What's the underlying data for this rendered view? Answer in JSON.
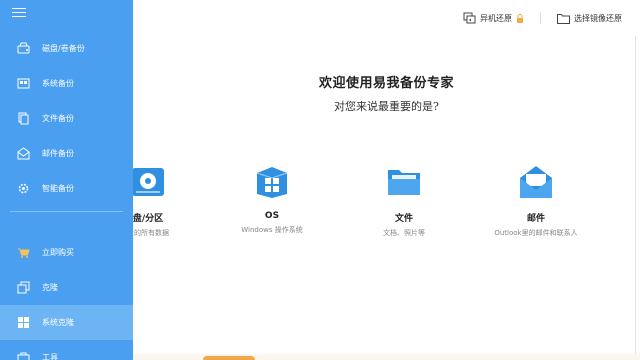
{
  "topbar": {
    "restore_label": "异机还原",
    "image_restore_label": "选择镜像还原"
  },
  "sidebar": {
    "items": [
      {
        "label": "磁盘/卷备份",
        "icon": "disk-icon"
      },
      {
        "label": "系统备份",
        "icon": "system-backup-icon"
      },
      {
        "label": "文件备份",
        "icon": "file-icon"
      },
      {
        "label": "邮件备份",
        "icon": "mail-icon"
      },
      {
        "label": "智能备份",
        "icon": "smart-backup-icon"
      },
      {
        "label": "立即购买",
        "icon": "cart-icon"
      },
      {
        "label": "克隆",
        "icon": "clone-icon"
      },
      {
        "label": "系统克隆",
        "icon": "windows-icon"
      },
      {
        "label": "工具",
        "icon": "tools-icon"
      }
    ]
  },
  "welcome": {
    "title": "欢迎使用易我备份专家",
    "subtitle": "对您来说最重要的是?"
  },
  "cards": [
    {
      "title": "盘/分区",
      "subtitle": "上的所有数据"
    },
    {
      "title": "OS",
      "subtitle": "Windows 操作系统"
    },
    {
      "title": "文件",
      "subtitle": "文档、照片等"
    },
    {
      "title": "邮件",
      "subtitle": "Outlook里的邮件和联系人"
    }
  ],
  "colors": {
    "sidebar": "#4a9ff0",
    "sidebar_active": "#6db4f4",
    "icon_blue": "#2f8fe0",
    "lock": "#f2a74b"
  }
}
